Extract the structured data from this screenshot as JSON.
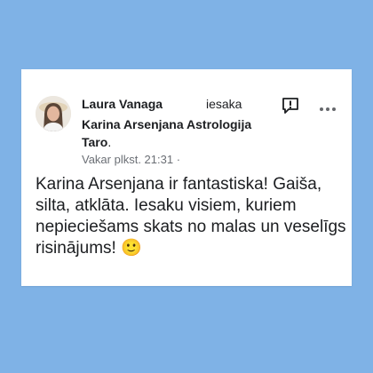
{
  "post": {
    "author": "Laura Vanaga",
    "verb": "iesaka",
    "page_name": "Karina Arsenjana Astrologija Taro",
    "page_suffix": ".",
    "timestamp": "Vakar plkst. 21:31",
    "separator": "·",
    "text": "Karina Arsenjana ir fantastiska! Gaiša, silta, atklāta. Iesaku visiem, kuriem nepieciešams skats no malas un veselīgs risinājums! 🙂"
  },
  "icons": {
    "report": "report-icon",
    "more": "more-options-icon"
  },
  "colors": {
    "background": "#7fb2e6",
    "card": "#ffffff",
    "text": "#1c1e21",
    "meta": "#6b6f75"
  }
}
